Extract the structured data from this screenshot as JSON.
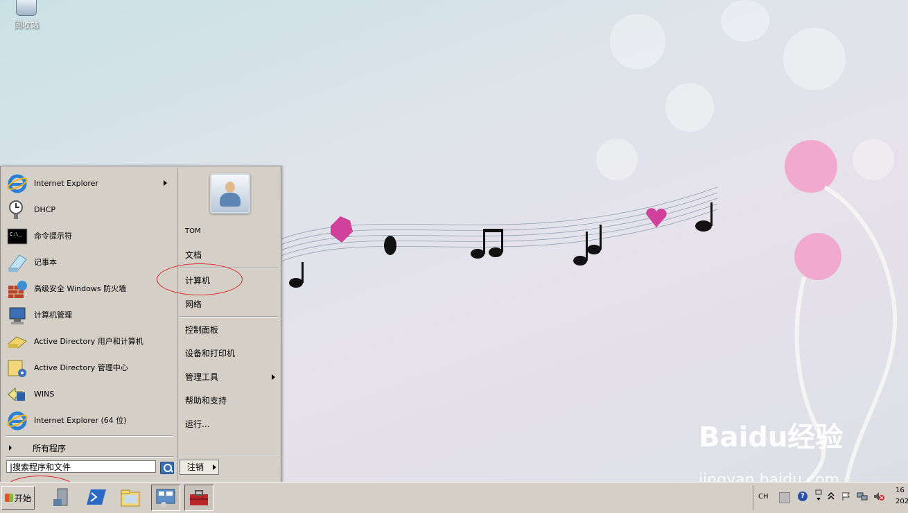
{
  "desktop": {
    "recycle_bin_label": "回收站"
  },
  "start_menu": {
    "programs": [
      {
        "label": "Internet Explorer",
        "icon": "ie-icon",
        "has_submenu": true
      },
      {
        "label": "DHCP",
        "icon": "dhcp-icon"
      },
      {
        "label": "命令提示符",
        "icon": "cmd-icon"
      },
      {
        "label": "记事本",
        "icon": "notepad-icon"
      },
      {
        "label": "高级安全 Windows 防火墙",
        "icon": "firewall-icon"
      },
      {
        "label": "计算机管理",
        "icon": "computer-management-icon"
      },
      {
        "label": "Active Directory 用户和计算机",
        "icon": "ad-users-icon"
      },
      {
        "label": "Active Directory 管理中心",
        "icon": "ad-admin-center-icon"
      },
      {
        "label": "WINS",
        "icon": "wins-icon"
      },
      {
        "label": "Internet Explorer (64 位)",
        "icon": "ie-icon"
      }
    ],
    "all_programs_label": "所有程序",
    "search_placeholder": "搜索程序和文件",
    "right_items": {
      "user": "TOM",
      "documents": "文档",
      "computer": "计算机",
      "network": "网络",
      "control_panel": "控制面板",
      "devices_printers": "设备和打印机",
      "admin_tools": "管理工具",
      "help_support": "帮助和支持",
      "run": "运行..."
    },
    "logoff_label": "注销"
  },
  "taskbar": {
    "start_label": "开始",
    "language": "CH",
    "clock_time": "16",
    "clock_date": "202"
  },
  "watermark": {
    "logo": "Baidu经验",
    "url": "jingyan.baidu.com"
  }
}
